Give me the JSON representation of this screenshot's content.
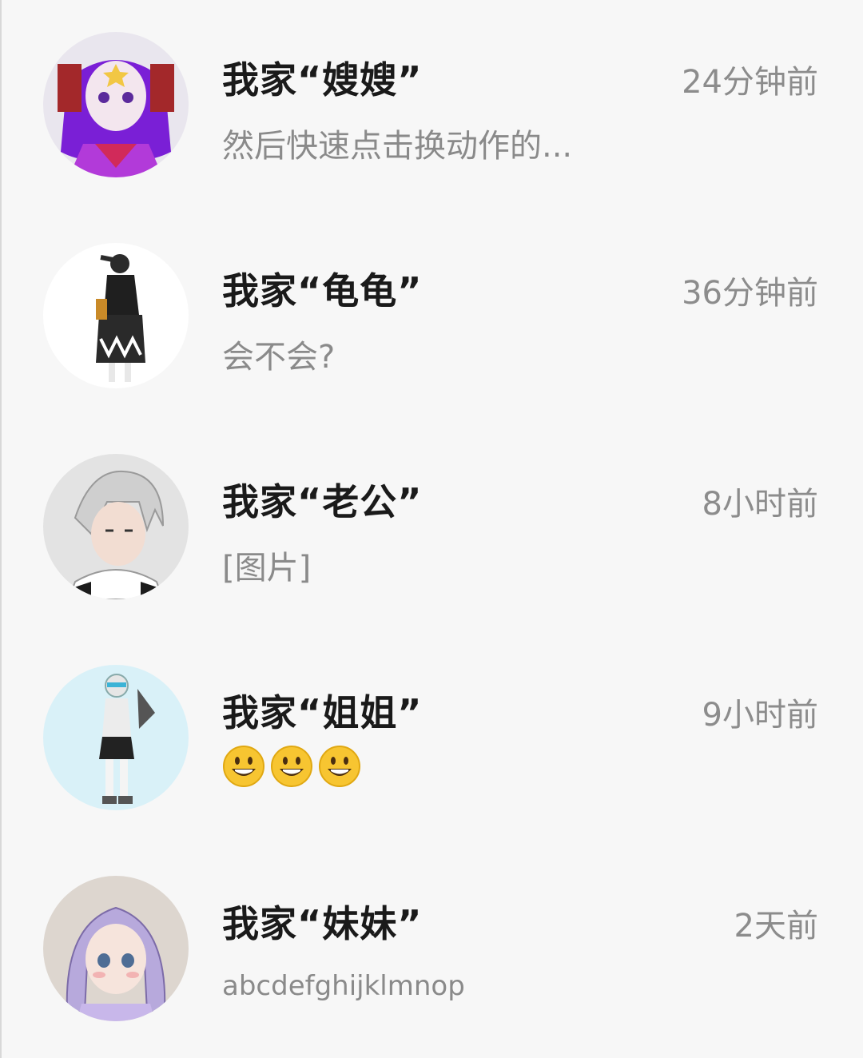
{
  "chats": [
    {
      "name": "我家“嫂嫂”",
      "time": "24分钟前",
      "preview": "然后快速点击换动作的...",
      "avatar": "purple-hair-anime-avatar"
    },
    {
      "name": "我家“龟龟”",
      "time": "36分钟前",
      "preview": "会不会?",
      "avatar": "gothic-dress-girl-avatar"
    },
    {
      "name": "我家“老公”",
      "time": "8小时前",
      "preview": "[图片]",
      "avatar": "silver-hair-boy-avatar"
    },
    {
      "name": "我家“姐姐”",
      "time": "9小时前",
      "preview_emojis": [
        "grinning-face",
        "grinning-face",
        "grinning-face"
      ],
      "avatar": "white-hair-robot-girl-avatar"
    },
    {
      "name": "我家“妹妹”",
      "time": "2天前",
      "preview": "abcdefghijklmnop",
      "avatar": "lavender-hair-girl-avatar"
    }
  ],
  "colors": {
    "background": "#f7f7f7",
    "name": "#1a1a1a",
    "secondary": "#8a8a8a"
  }
}
